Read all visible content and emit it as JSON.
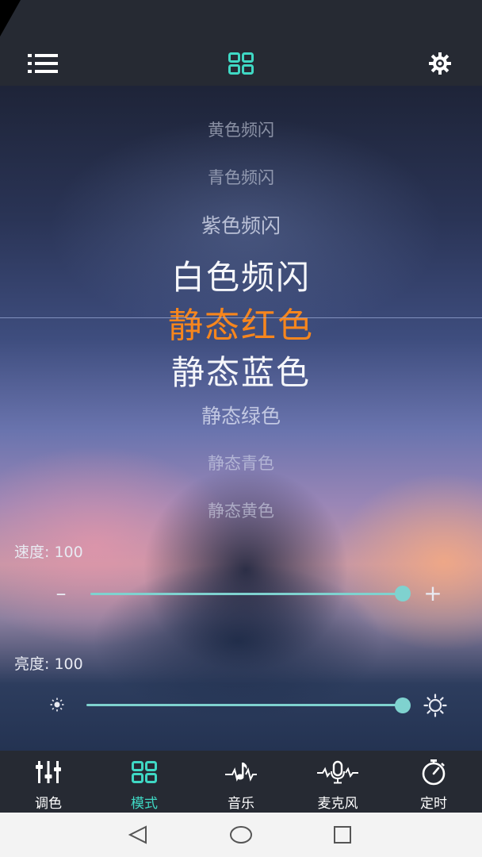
{
  "header": {
    "menu_icon": "menu-list-icon",
    "mode_icon": "grid-icon",
    "settings_icon": "gear-icon"
  },
  "modes": {
    "items": [
      "黄色频闪",
      "青色频闪",
      "紫色频闪",
      "白色频闪",
      "静态红色",
      "静态蓝色",
      "静态绿色",
      "静态青色",
      "静态黄色"
    ],
    "selected": "静态红色",
    "selected_color": "#f7861d"
  },
  "speed": {
    "label": "速度:",
    "value": "100",
    "level": 1.0,
    "minus": "–",
    "plus": "+"
  },
  "brightness": {
    "label": "亮度:",
    "value": "100",
    "level": 1.0
  },
  "bottom_nav": [
    {
      "label": "调色",
      "icon": "sliders-icon"
    },
    {
      "label": "模式",
      "icon": "grid-icon",
      "active": true
    },
    {
      "label": "音乐",
      "icon": "music-note-icon"
    },
    {
      "label": "麦克风",
      "icon": "microphone-icon"
    },
    {
      "label": "定时",
      "icon": "timer-icon"
    }
  ],
  "colors": {
    "accent": "#3fd8c4",
    "slider": "#7fd2cf",
    "bar_bg": "#262a33"
  }
}
